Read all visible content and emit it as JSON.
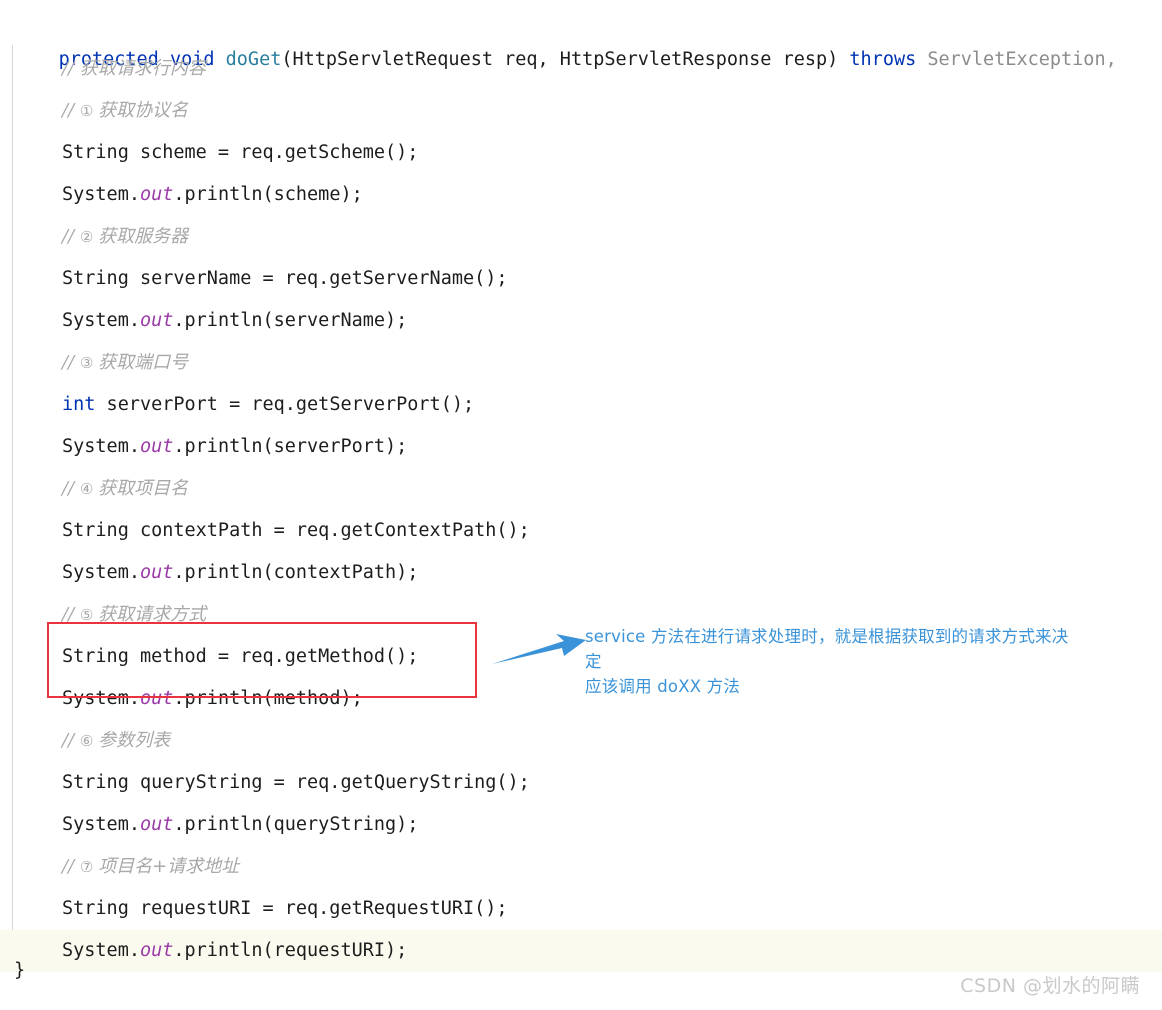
{
  "editor": {
    "language": "java",
    "colors": {
      "keyword": "#0033b3",
      "method_name": "#2a7f9e",
      "static_field": "#9b3ba8",
      "comment": "#a8a8a8",
      "dim_type": "#8c8c8c",
      "plain": "#1d1d1d",
      "callout_border": "#e8343c",
      "annotation": "#3a93d8",
      "current_line_bg": "#fbfaef",
      "indent_guide": "#d8d8d8",
      "background": "#ffffff"
    },
    "signature": {
      "kw_protected": "protected",
      "kw_void": "void",
      "method_name": "doGet",
      "params": "(HttpServletRequest req, HttpServletResponse resp) ",
      "kw_throws": "throws",
      "exception": " ServletException,"
    },
    "closing_brace": "}",
    "lines": [
      {
        "kind": "comment",
        "text": "// ",
        "cn": "获取请求行内容"
      },
      {
        "kind": "comment",
        "text": "// ",
        "num": "①",
        "cn": "获取协议名"
      },
      {
        "kind": "code",
        "kw": "",
        "body": "String scheme = req.getScheme();"
      },
      {
        "kind": "print",
        "pre": "System.",
        "static": "out",
        "post": ".println(scheme);"
      },
      {
        "kind": "comment",
        "text": "// ",
        "num": "②",
        "cn": "获取服务器"
      },
      {
        "kind": "code",
        "kw": "",
        "body": "String serverName = req.getServerName();"
      },
      {
        "kind": "print",
        "pre": "System.",
        "static": "out",
        "post": ".println(serverName);"
      },
      {
        "kind": "comment",
        "text": "// ",
        "num": "③",
        "cn": "获取端口号"
      },
      {
        "kind": "code",
        "kw": "int",
        "body": " serverPort = req.getServerPort();"
      },
      {
        "kind": "print",
        "pre": "System.",
        "static": "out",
        "post": ".println(serverPort);"
      },
      {
        "kind": "comment",
        "text": "// ",
        "num": "④",
        "cn": "获取项目名"
      },
      {
        "kind": "code",
        "kw": "",
        "body": "String contextPath = req.getContextPath();"
      },
      {
        "kind": "print",
        "pre": "System.",
        "static": "out",
        "post": ".println(contextPath);"
      },
      {
        "kind": "comment",
        "text": "// ",
        "num": "⑤",
        "cn": "获取请求方式"
      },
      {
        "kind": "code",
        "kw": "",
        "body": "String method = req.getMethod();"
      },
      {
        "kind": "print",
        "pre": "System.",
        "static": "out",
        "post": ".println(method);"
      },
      {
        "kind": "comment",
        "text": "// ",
        "num": "⑥",
        "cn": "参数列表"
      },
      {
        "kind": "code",
        "kw": "",
        "body": "String queryString = req.getQueryString();"
      },
      {
        "kind": "print",
        "pre": "System.",
        "static": "out",
        "post": ".println(queryString);"
      },
      {
        "kind": "comment",
        "text": "// ",
        "num": "⑦",
        "cn": "项目名+请求地址"
      },
      {
        "kind": "code",
        "kw": "",
        "body": "String requestURI = req.getRequestURI();"
      },
      {
        "kind": "print",
        "pre": "System.",
        "static": "out",
        "post": ".println(requestURI);",
        "highlighted": true
      }
    ]
  },
  "callout": {
    "box_label": "highlighted-code-block",
    "arrow_label": "annotation-arrow",
    "annotation_line1": "service  方法在进行请求处理时，就是根据获取到的请求方式来决定",
    "annotation_line2": "应该调用 doXX 方法"
  },
  "watermark": {
    "text": "CSDN @划水的阿瞒"
  }
}
